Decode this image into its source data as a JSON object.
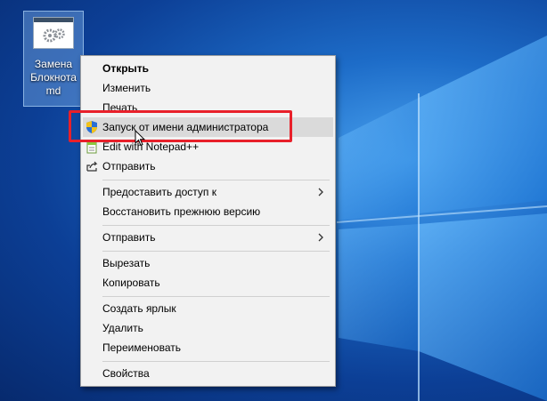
{
  "desktop_icon": {
    "label": "Замена\nБлокнота\nmd",
    "icon": "notepad-gears-icon"
  },
  "context_menu": {
    "items": [
      {
        "label": "Открыть",
        "bold": true
      },
      {
        "label": "Изменить"
      },
      {
        "label": "Печать"
      },
      {
        "label": "Запуск от имени администратора",
        "icon": "uac-shield-icon",
        "highlighted": true
      },
      {
        "label": "Edit with Notepad++",
        "icon": "notepadpp-icon"
      },
      {
        "label": "Отправить",
        "icon": "share-icon"
      },
      {
        "label": "Предоставить доступ к",
        "submenu": true
      },
      {
        "label": "Восстановить прежнюю версию"
      },
      {
        "label": "Отправить",
        "submenu": true
      },
      {
        "label": "Вырезать"
      },
      {
        "label": "Копировать"
      },
      {
        "label": "Создать ярлык"
      },
      {
        "label": "Удалить"
      },
      {
        "label": "Переименовать"
      },
      {
        "label": "Свойства"
      }
    ]
  },
  "highlight_color": "#e8202a"
}
